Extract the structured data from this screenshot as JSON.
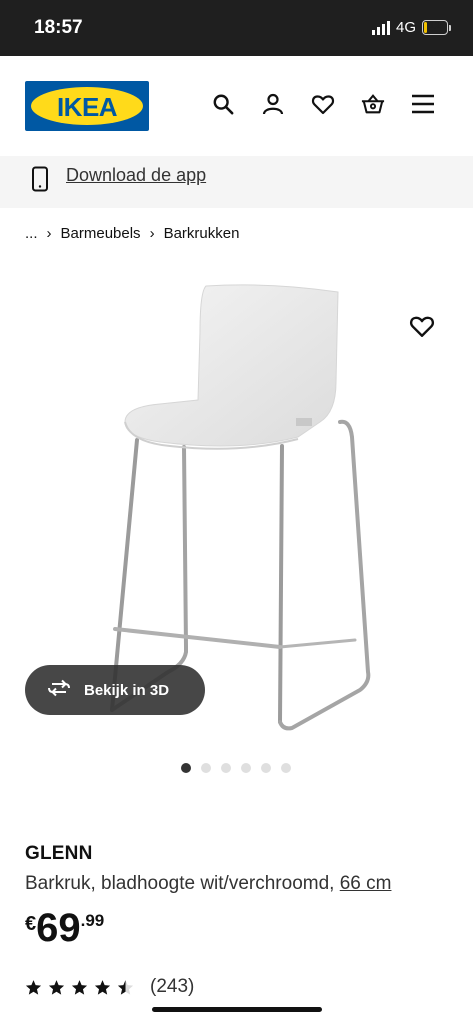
{
  "status_bar": {
    "time": "18:57",
    "network": "4G",
    "battery": "12",
    "battery_fraction": 0.12
  },
  "header": {
    "logo_text": "IKEA",
    "icons": [
      "search-icon",
      "account-icon",
      "favorites-heart-icon",
      "cart-basket-icon",
      "menu-icon"
    ]
  },
  "app_banner": {
    "link_label": "Download de app"
  },
  "breadcrumb": {
    "ellipsis": "...",
    "separator": "›",
    "items": [
      "Barmeubels",
      "Barkrukken"
    ]
  },
  "gallery": {
    "view_3d_label": "Bekijk in 3D",
    "image_count": 6,
    "active_index": 0
  },
  "product": {
    "name": "GLENN",
    "description": "Barkruk, bladhoogte wit/verchroomd,",
    "size_link": "66 cm",
    "currency": "€",
    "price_int": "69",
    "price_dec": ".99",
    "rating_value": 4.5,
    "rating_max": 5,
    "review_count": "(243)"
  },
  "colors": {
    "ikea_blue": "#0058a3",
    "ikea_yellow": "#ffda1a",
    "text": "#111111"
  }
}
